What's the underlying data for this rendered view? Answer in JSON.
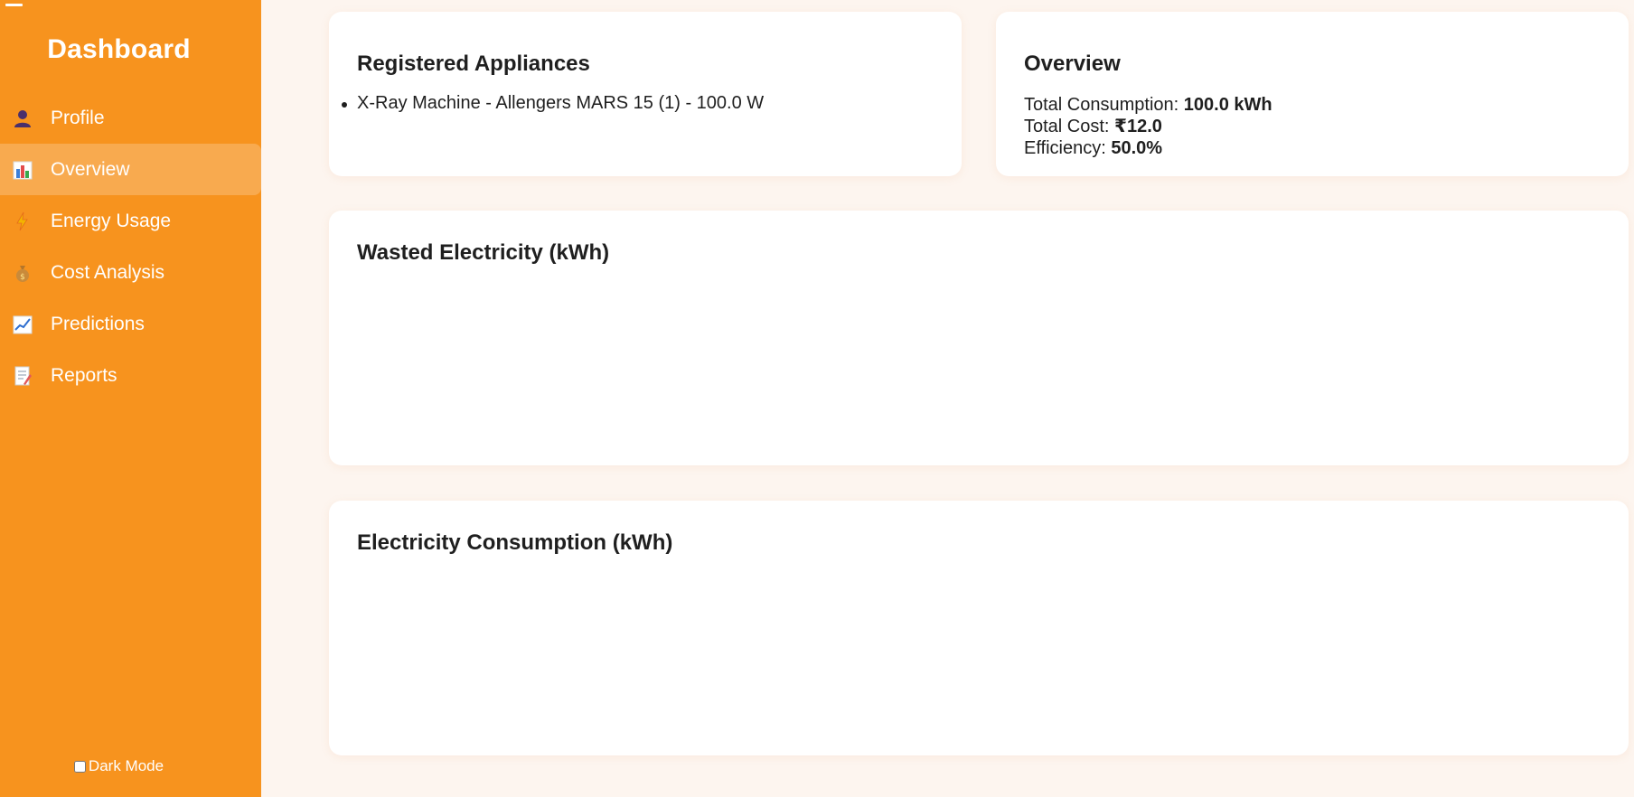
{
  "sidebar": {
    "title": "Dashboard",
    "items": [
      {
        "label": "Profile",
        "icon": "user-icon"
      },
      {
        "label": "Overview",
        "icon": "bar-chart-icon",
        "active": true
      },
      {
        "label": "Energy Usage",
        "icon": "lightning-icon"
      },
      {
        "label": "Cost Analysis",
        "icon": "money-bag-icon"
      },
      {
        "label": "Predictions",
        "icon": "trend-chart-icon"
      },
      {
        "label": "Reports",
        "icon": "memo-icon"
      }
    ],
    "dark_mode_label": "Dark Mode",
    "dark_mode_checked": false
  },
  "appliances": {
    "title": "Registered Appliances",
    "items": [
      "X-Ray Machine - Allengers MARS 15 (1) - 100.0 W"
    ]
  },
  "overview": {
    "title": "Overview",
    "consumption_label": "Total Consumption: ",
    "consumption_value": "100.0 kWh",
    "cost_label": "Total Cost: ",
    "cost_value": "₹12.0",
    "efficiency_label": "Efficiency: ",
    "efficiency_value": "50.0%"
  },
  "wasted_chart": {
    "title": "Wasted Electricity (kWh)"
  },
  "consumption_chart": {
    "title": "Electricity Consumption (kWh)"
  },
  "colors": {
    "sidebar": "#f7931e",
    "background": "#fdf5ef",
    "card": "#ffffff"
  }
}
